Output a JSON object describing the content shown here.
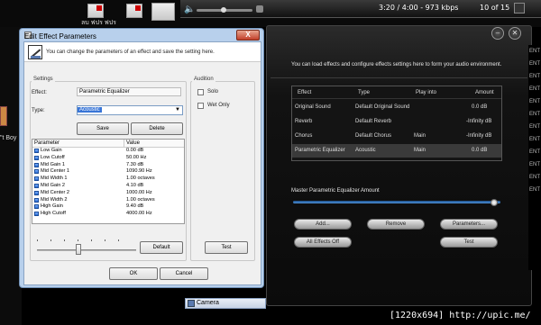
{
  "desktop": {
    "top_label": "ลบ ฟปร ฟปร",
    "left_label": "\"t Boy",
    "taskbar_camera": "Camera"
  },
  "player": {
    "status": "3:20 / 4:00 - 973 kbps",
    "track_count": "10 of 15"
  },
  "dialog": {
    "title": "Edit Effect Parameters",
    "close": "X",
    "info": "You can change the parameters of an effect and save the setting here.",
    "settings_label": "Settings",
    "effect_label": "Effect:",
    "effect_value": "Parametric Equalizer",
    "type_label": "Type:",
    "type_value": "Acoustic",
    "save": "Save",
    "delete": "Delete",
    "audition_label": "Audition",
    "solo": "Solo",
    "wet_only": "Wet Only",
    "col_parameter": "Parameter",
    "col_value": "Value",
    "parameters": [
      {
        "name": "Low Gain",
        "value": "0.00 dB"
      },
      {
        "name": "Low Cutoff",
        "value": "50.00 Hz"
      },
      {
        "name": "Mid Gain 1",
        "value": "7.30 dB"
      },
      {
        "name": "Mid Center 1",
        "value": "1090.90 Hz"
      },
      {
        "name": "Mid Width 1",
        "value": "1.00 octaves"
      },
      {
        "name": "Mid Gain 2",
        "value": "4.10 dB"
      },
      {
        "name": "Mid Center 2",
        "value": "1000.00 Hz"
      },
      {
        "name": "Mid Width 2",
        "value": "1.00 octaves"
      },
      {
        "name": "High Gain",
        "value": "9.40 dB"
      },
      {
        "name": "High Cutoff",
        "value": "4000.00 Hz"
      }
    ],
    "default": "Default",
    "test": "Test",
    "ok": "OK",
    "cancel": "Cancel"
  },
  "effects_panel": {
    "description": "You can load effects and configure effects settings here to form your audio environment.",
    "columns": [
      "Effect",
      "Type",
      "Play into",
      "Amount"
    ],
    "rows": [
      {
        "effect": "Original Sound",
        "type": "Default Original Sound",
        "play_into": "",
        "amount": "0.0 dB"
      },
      {
        "effect": "Reverb",
        "type": "Default Reverb",
        "play_into": "",
        "amount": "-Infinity dB"
      },
      {
        "effect": "Chorus",
        "type": "Default Chorus",
        "play_into": "Main",
        "amount": "-Infinity dB"
      },
      {
        "effect": "Parametric Equalizer",
        "type": "Acoustic",
        "play_into": "Main",
        "amount": "0.0 dB"
      }
    ],
    "master_label": "Master Parametric Equalizer Amount",
    "master_level": 0.97,
    "add": "Add...",
    "remove": "Remove",
    "parameters": "Parameters...",
    "effects_off": "All Effects Off",
    "test": "Test",
    "right_strip": [
      "ENT",
      "ENT",
      "ENT",
      "ENT",
      "ENT",
      "ENT",
      "ENT",
      "ENT",
      "ENT",
      "ENT",
      "ENT",
      "ENT"
    ]
  },
  "watermark": "[1220x694] http://upic.me/"
}
